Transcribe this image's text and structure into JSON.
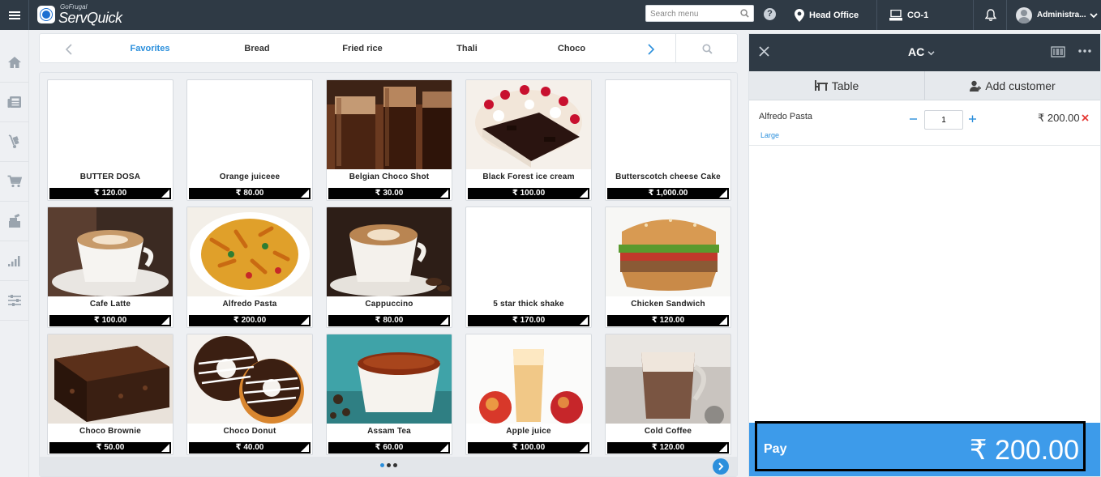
{
  "topbar": {
    "logo_small": "GoFrugal",
    "logo_big": "ServQuick",
    "search_placeholder": "Search menu",
    "help": "?",
    "location": "Head Office",
    "counter": "CO-1",
    "user": "Administra..."
  },
  "categories": {
    "tabs": [
      "Favorites",
      "Bread",
      "Fried rice",
      "Thali",
      "Choco"
    ],
    "active": "Favorites"
  },
  "products": [
    {
      "name": "BUTTER DOSA",
      "price": "₹ 120.00",
      "image": "none"
    },
    {
      "name": "Orange juiceee",
      "price": "₹ 80.00",
      "image": "none"
    },
    {
      "name": "Belgian Choco Shot",
      "price": "₹ 30.00",
      "image": "choco-shot"
    },
    {
      "name": "Black Forest ice cream",
      "price": "₹ 100.00",
      "image": "black-forest"
    },
    {
      "name": "Butterscotch cheese Cake",
      "price": "₹ 1,000.00",
      "image": "none"
    },
    {
      "name": "Cafe Latte",
      "price": "₹ 100.00",
      "image": "latte"
    },
    {
      "name": "Alfredo Pasta",
      "price": "₹ 200.00",
      "image": "pasta"
    },
    {
      "name": "Cappuccino",
      "price": "₹ 80.00",
      "image": "cappuccino"
    },
    {
      "name": "5 star thick shake",
      "price": "₹ 170.00",
      "image": "none"
    },
    {
      "name": "Chicken Sandwich",
      "price": "₹ 120.00",
      "image": "sandwich"
    },
    {
      "name": "Choco Brownie",
      "price": "₹ 50.00",
      "image": "brownie"
    },
    {
      "name": "Choco Donut",
      "price": "₹ 40.00",
      "image": "donut"
    },
    {
      "name": "Assam Tea",
      "price": "₹ 60.00",
      "image": "tea"
    },
    {
      "name": "Apple juice",
      "price": "₹ 100.00",
      "image": "apple-juice"
    },
    {
      "name": "Cold Coffee",
      "price": "₹ 120.00",
      "image": "cold-coffee"
    }
  ],
  "pager": {
    "pages": 3,
    "current": 1
  },
  "order": {
    "mode": "AC",
    "tabs": {
      "table": "Table",
      "customer": "Add customer"
    },
    "items": [
      {
        "name": "Alfredo Pasta",
        "variant": "Large",
        "qty": "1",
        "price": "₹ 200.00"
      }
    ],
    "pay_label": "Pay",
    "total": "₹ 200.00"
  },
  "colors": {
    "accent": "#2b8fdc",
    "topbar": "#2f3a45",
    "pay": "#3d9bea",
    "remove": "#e53935"
  }
}
